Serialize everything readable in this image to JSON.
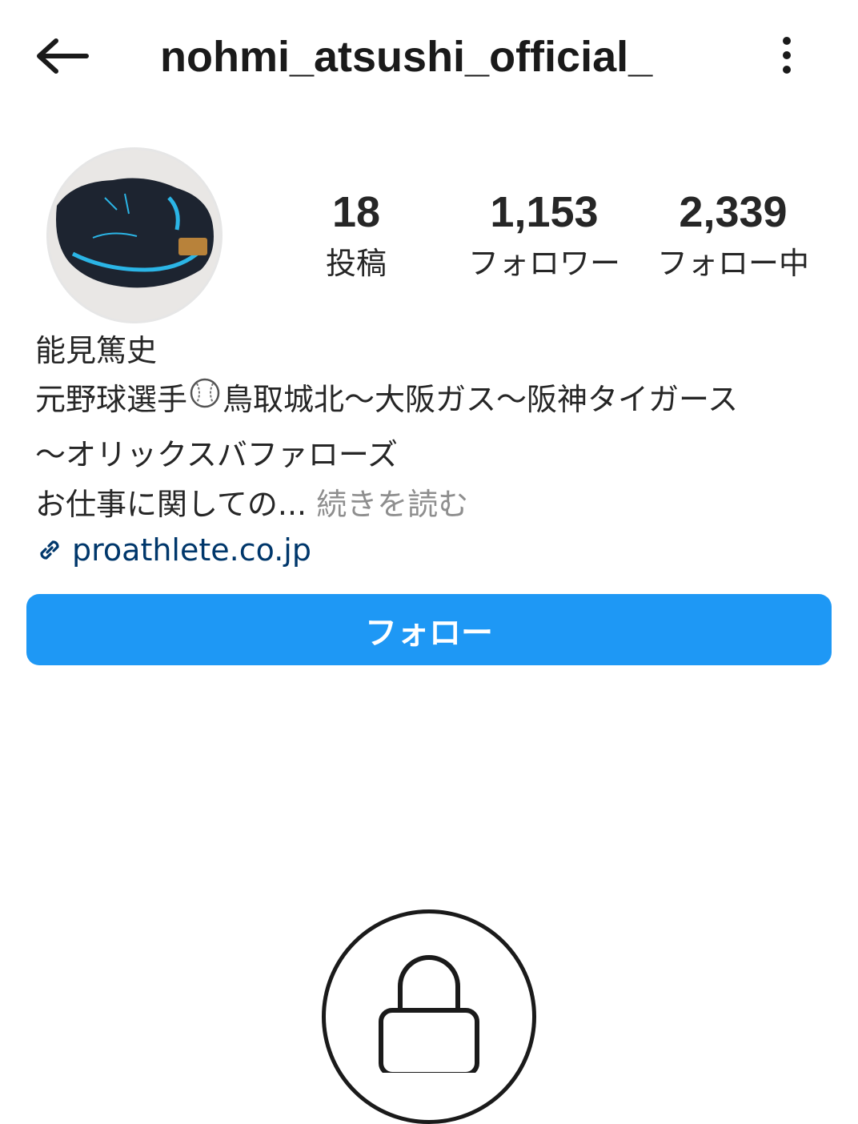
{
  "header": {
    "back_icon": "arrow-left-icon",
    "title": "nohmi_atsushi_official_",
    "more_icon": "more-vertical-icon"
  },
  "profile": {
    "avatar_icon": "baseball-glove-photo",
    "stats": {
      "posts": {
        "value": "18",
        "label": "投稿"
      },
      "followers": {
        "value": "1,153",
        "label": "フォロワー"
      },
      "following": {
        "value": "2,339",
        "label": "フォロー中"
      }
    },
    "bio": {
      "name": "能見篤史",
      "line1_prefix": "元野球選手",
      "line1_icon": "baseball-emoji",
      "line1_suffix": "鳥取城北〜大阪ガス〜阪神タイガース",
      "line2": "〜オリックスバファローズ",
      "line3_text": "お仕事に関しての...",
      "line3_more": "続きを読む",
      "link_icon": "link-icon",
      "link_text": "proathlete.co.jp"
    }
  },
  "follow_button": {
    "label": "フォロー",
    "color": "#1e98f5"
  },
  "private": {
    "lock_icon": "lock-icon"
  },
  "colors": {
    "text": "#262626",
    "link": "#00376b",
    "muted": "#8e8e8e",
    "accent": "#1e98f5"
  }
}
